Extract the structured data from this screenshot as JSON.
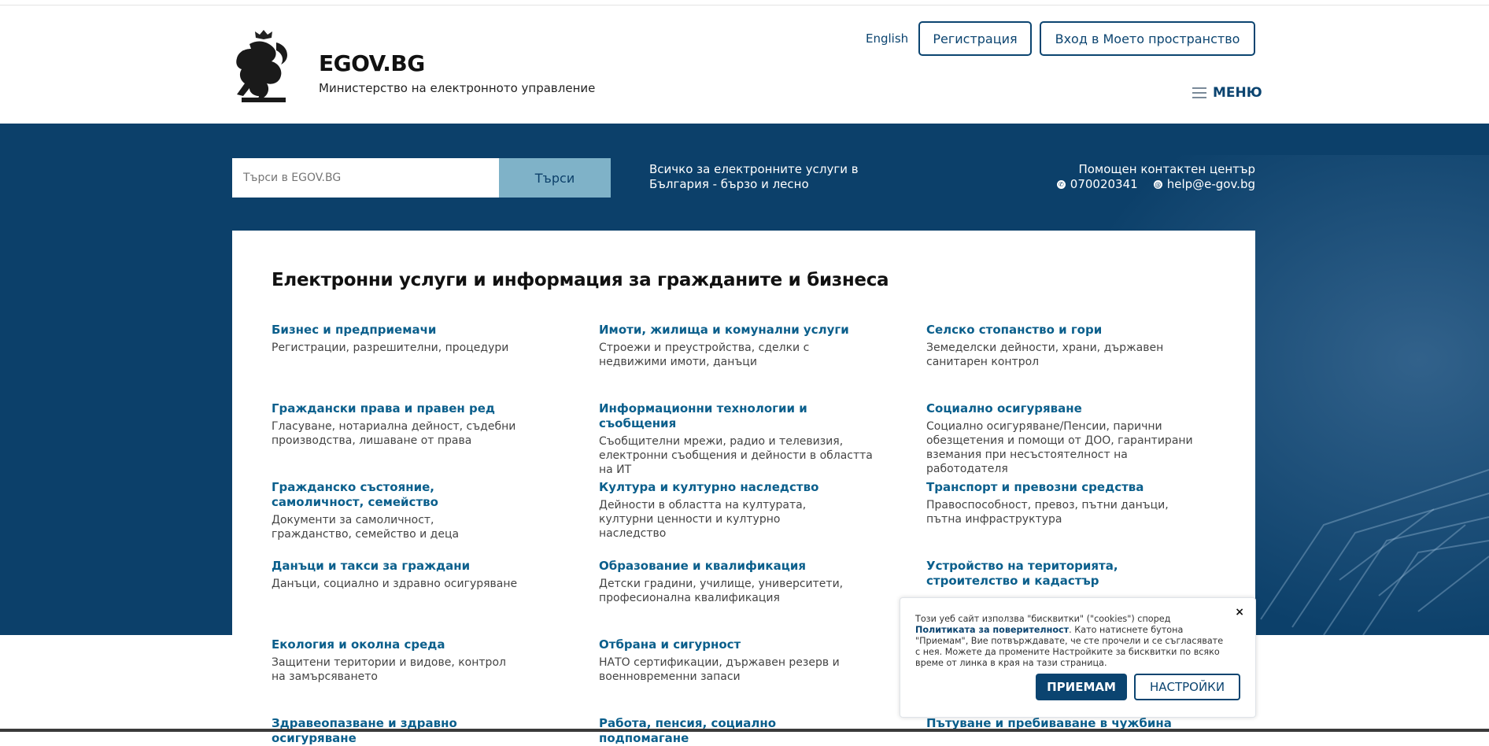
{
  "header": {
    "brand_title": "EGOV.BG",
    "brand_subtitle": "Министерство на електронното управление",
    "language_link": "English",
    "register_label": "Регистрация",
    "login_label": "Вход в Моето пространство",
    "menu_label": "МЕНЮ"
  },
  "hero": {
    "search_placeholder": "Търси в EGOV.BG",
    "search_button": "Търси",
    "tagline": "Всичко за електронните услуги в България - бързо и лесно",
    "contact_title": "Помощен контактен център",
    "phone": "070020341",
    "email": "help@e-gov.bg"
  },
  "main": {
    "title": "Електронни услуги и информация за гражданите и бизнеса",
    "services": [
      {
        "title": "Бизнес и предприемачи",
        "desc": "Регистрации, разрешителни, процедури"
      },
      {
        "title": "Имоти, жилища и комунални услуги",
        "desc": "Строежи и преустройства, сделки с недвижими имоти, данъци"
      },
      {
        "title": "Селско стопанство и гори",
        "desc": "Земеделски дейности, храни, държавен санитарен контрол"
      },
      {
        "title": "Граждански права и правен ред",
        "desc": "Гласуване, нотариална дейност, съдебни производства, лишаване от права"
      },
      {
        "title": "Информационни технологии и съобщения",
        "desc": "Съобщителни мрежи, радио и телевизия, електронни съобщения и дейности в областта на ИТ"
      },
      {
        "title": "Социално осигуряване",
        "desc": "Социално осигуряване/Пенсии, парични обезщетения и помощи от ДОО, гарантирани вземания при несъстоятелност на работодателя"
      },
      {
        "title": "Гражданско състояние, самоличност, семейство",
        "desc": "Документи за самоличност, гражданство, семейство и деца"
      },
      {
        "title": "Култура и културно наследство",
        "desc": "Дейности в областта на културата, културни ценности и културно наследство"
      },
      {
        "title": "Транспорт и превозни средства",
        "desc": "Правоспособност, превоз, пътни данъци, пътна инфраструктура"
      },
      {
        "title": "Данъци и такси за граждани",
        "desc": "Данъци, социално и здравно осигуряване"
      },
      {
        "title": "Образование и квалификация",
        "desc": "Детски градини, училище, университети, професионална квалификация"
      },
      {
        "title": "Устройство на територията, строителство и кадастър",
        "desc": ""
      },
      {
        "title": "Екология и околна среда",
        "desc": "Защитени територии и видове, контрол на замърсяването"
      },
      {
        "title": "Отбрана и сигурност",
        "desc": "НАТО сертификации, държавен резерв и военновременни запаси"
      },
      {
        "title": "Здравеопазване и здравно осигуряване",
        "desc": ""
      },
      {
        "title": "Работа, пенсия, социално подпомагане",
        "desc": ""
      },
      {
        "title": "Пътуване и пребиваване в чужбина",
        "desc": ""
      }
    ]
  },
  "cookie": {
    "text_before": "Този уеб сайт използва \"бисквитки\" (\"cookies\") според ",
    "policy_link": "Политиката за поверителност",
    "text_after": ". Като натиснете бутона \"Приемам\", Вие потвърждавате, че сте прочели и се съгласявате с нея. Можете да промените Настройките за бисквитки по всяко време от линка в края на тази страница.",
    "close_symbol": "×",
    "accept_label": "ПРИЕМАМ",
    "settings_label": "НАСТРОЙКИ"
  },
  "colors": {
    "primary": "#0b4470",
    "hero_bg": "#0c406a",
    "search_button_bg": "#7fb2c8",
    "link": "#0b5f8c"
  }
}
